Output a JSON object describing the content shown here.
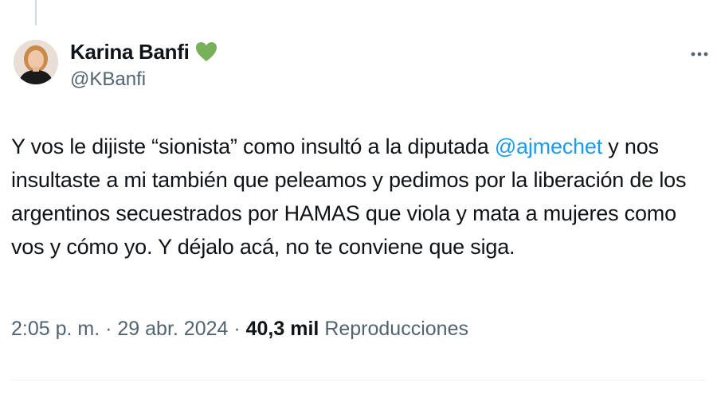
{
  "author": {
    "display_name": "Karina Banfi",
    "badge_icon": "green-heart-icon",
    "badge_color": "#78b159",
    "handle": "@KBanfi"
  },
  "more_icon": "more-icon",
  "tweet": {
    "text_before_mention": "Y vos le dijiste “sionista” como insultó a la diputada ",
    "mention": "@ajmechet",
    "text_after_mention": " y nos insultaste a mi también que peleamos y pedimos por la liberación de los argentinos secuestrados por HAMAS que viola y mata a mujeres como vos y cómo yo. Y déjalo acá, no te conviene que siga."
  },
  "meta": {
    "time": "2:05 p. m.",
    "separator": " · ",
    "date": "29 abr. 2024",
    "views_count": "40,3 mil",
    "views_label": "Reproducciones"
  },
  "colors": {
    "link": "#1d9bf0",
    "secondary_text": "#536471",
    "primary_text": "#0f1419"
  }
}
